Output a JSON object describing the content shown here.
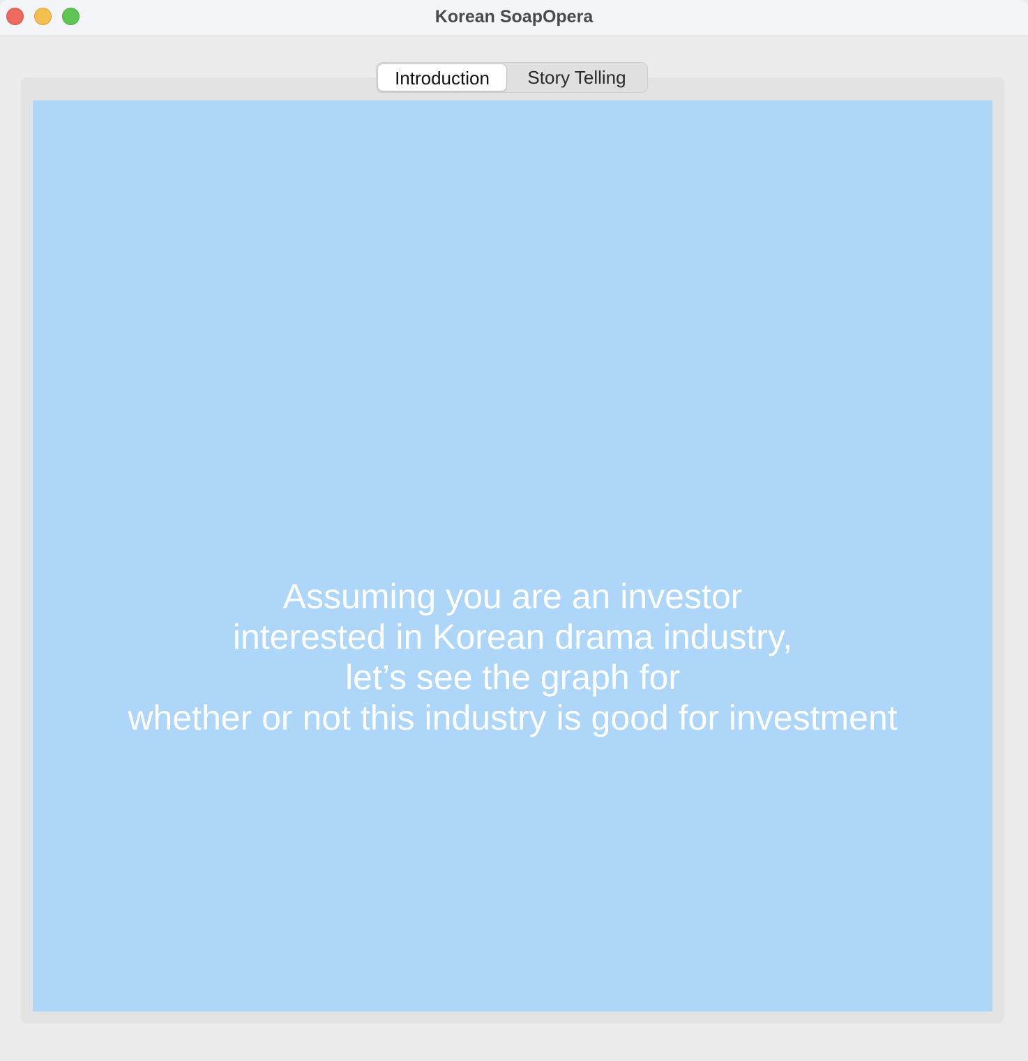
{
  "window": {
    "title": "Korean SoapOpera"
  },
  "tabs": [
    {
      "label": "Introduction",
      "selected": true
    },
    {
      "label": "Story Telling",
      "selected": false
    }
  ],
  "intro": {
    "background_color": "#add6f8",
    "lines": [
      "Assuming you are an investor",
      "interested in Korean drama industry,",
      "let’s see the graph for",
      "whether or not this industry is good for investment"
    ]
  }
}
